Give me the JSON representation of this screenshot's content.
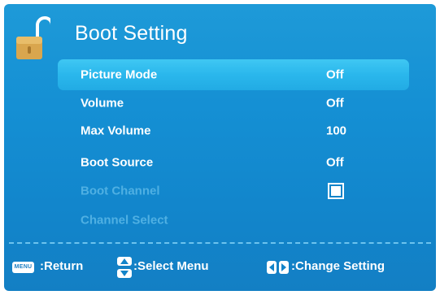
{
  "header": {
    "title": "Boot Setting",
    "icon": "padlock-open-icon"
  },
  "menu": {
    "items": [
      {
        "label": "Picture Mode",
        "value": "Off",
        "selected": true,
        "enabled": true
      },
      {
        "label": "Volume",
        "value": "Off",
        "selected": false,
        "enabled": true
      },
      {
        "label": "Max Volume",
        "value": "100",
        "selected": false,
        "enabled": true
      },
      {
        "label": "Boot Source",
        "value": "Off",
        "selected": false,
        "enabled": true
      },
      {
        "label": "Boot Channel",
        "value": "",
        "control": "checkbox",
        "checked": true,
        "selected": false,
        "enabled": false
      },
      {
        "label": "Channel Select",
        "value": "",
        "selected": false,
        "enabled": false
      }
    ]
  },
  "footer": {
    "menu_key": "MENU",
    "return_label": ":Return",
    "select_label": ":Select Menu",
    "change_label": ":Change  Setting"
  },
  "colors": {
    "background": "#1590d4",
    "highlight": "#2ab7ec",
    "disabled_text": "#4fb0e3",
    "text": "#ffffff"
  }
}
